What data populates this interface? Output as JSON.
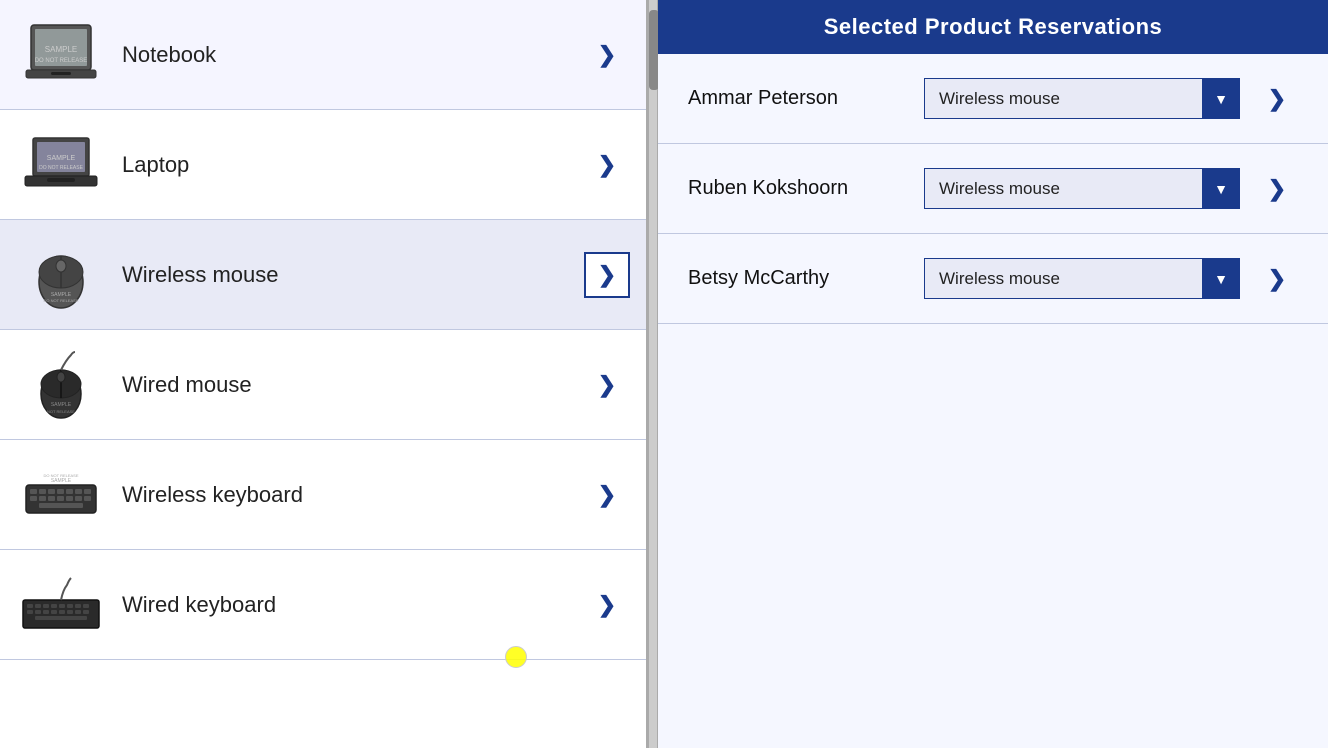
{
  "header": {
    "title": "Selected Product Reservations"
  },
  "products": [
    {
      "id": "notebook",
      "name": "Notebook",
      "selected": false
    },
    {
      "id": "laptop",
      "name": "Laptop",
      "selected": false
    },
    {
      "id": "wireless-mouse",
      "name": "Wireless mouse",
      "selected": true
    },
    {
      "id": "wired-mouse",
      "name": "Wired mouse",
      "selected": false
    },
    {
      "id": "wireless-keyboard",
      "name": "Wireless keyboard",
      "selected": false
    },
    {
      "id": "wired-keyboard",
      "name": "Wired keyboard",
      "selected": false
    }
  ],
  "reservations": [
    {
      "id": "ammar",
      "name": "Ammar Peterson",
      "product": "Wireless mouse"
    },
    {
      "id": "ruben",
      "name": "Ruben Kokshoorn",
      "product": "Wireless mouse"
    },
    {
      "id": "betsy",
      "name": "Betsy McCarthy",
      "product": "Wireless mouse"
    }
  ],
  "product_options": [
    "Notebook",
    "Laptop",
    "Wireless mouse",
    "Wired mouse",
    "Wireless keyboard",
    "Wired keyboard"
  ],
  "chevron": "❯"
}
